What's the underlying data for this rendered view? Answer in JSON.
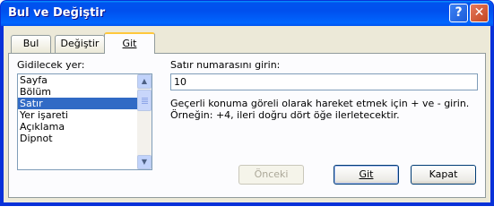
{
  "window": {
    "title": "Bul ve Değiştir"
  },
  "titlebar": {
    "help_glyph": "?",
    "close_glyph": "✕"
  },
  "tabs": [
    {
      "label": "Bul",
      "active": false
    },
    {
      "label": "Değiştir",
      "active": false
    },
    {
      "label": "Git",
      "active": true
    }
  ],
  "goto": {
    "list_label": "Gidilecek yer:",
    "items": [
      "Sayfa",
      "Bölüm",
      "Satır",
      "Yer işareti",
      "Açıklama",
      "Dipnot"
    ],
    "selected": "Satır",
    "input_label": "Satır numarasını girin:",
    "input_value": "10",
    "description": "Geçerli konuma göreli olarak hareket etmek için + ve - girin. Örneğin: +4, ileri doğru dört öğe ilerletecektir."
  },
  "buttons": {
    "previous": "Önceki",
    "goto": "Git",
    "close": "Kapat"
  },
  "icons": {
    "help": "help-icon",
    "close": "close-icon",
    "scroll_up": "scroll-up-arrow-icon",
    "scroll_down": "scroll-down-arrow-icon"
  }
}
